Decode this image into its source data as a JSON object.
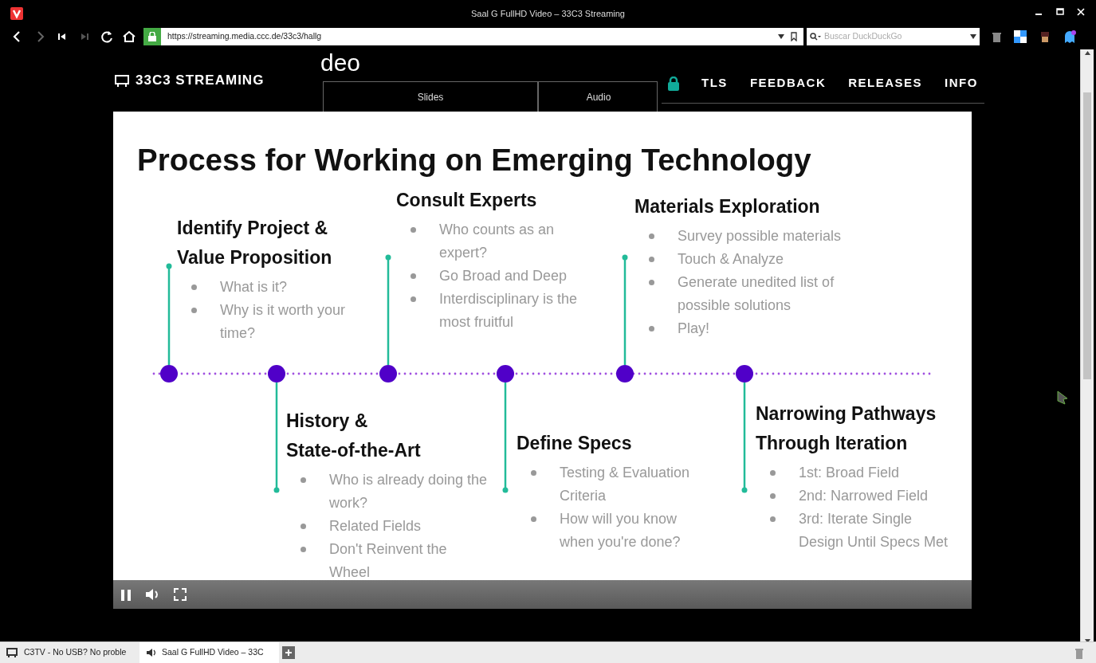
{
  "window": {
    "title": "Saal G FullHD Video – 33C3 Streaming"
  },
  "toolbar": {
    "url": "https://streaming.media.ccc.de/33c3/hallg",
    "search_placeholder": "Buscar DuckDuckGo"
  },
  "page": {
    "logo": "33C3 STREAMING",
    "heading_fragment": "deo",
    "tabs": [
      {
        "label": "Slides",
        "selected": false
      },
      {
        "label": "Audio",
        "selected": false
      }
    ],
    "nav": [
      "TLS",
      "FEEDBACK",
      "RELEASES",
      "INFO"
    ]
  },
  "slide": {
    "title": "Process for Working on Emerging Technology",
    "milestones": [
      {
        "kind": "above",
        "heading": [
          "Identify Project &",
          "Value Proposition"
        ],
        "bullets": [
          "What is it?",
          "Why is it worth your time?"
        ]
      },
      {
        "kind": "below",
        "heading": [
          "History &",
          "State-of-the-Art"
        ],
        "bullets": [
          "Who is already doing the work?",
          "Related Fields",
          "Don't Reinvent the Wheel"
        ]
      },
      {
        "kind": "above",
        "heading": [
          "Consult Experts"
        ],
        "bullets": [
          "Who counts as an expert?",
          "Go Broad and Deep",
          "Interdisciplinary is the most fruitful"
        ]
      },
      {
        "kind": "below",
        "heading": [
          "Define Specs"
        ],
        "bullets": [
          "Testing & Evaluation Criteria",
          "How will you know when you're done?"
        ]
      },
      {
        "kind": "above",
        "heading": [
          "Materials Exploration"
        ],
        "bullets": [
          "Survey possible materials",
          "Touch & Analyze",
          "Generate unedited list of possible solutions",
          "Play!"
        ]
      },
      {
        "kind": "below",
        "heading": [
          "Narrowing Pathways",
          "Through Iteration"
        ],
        "bullets": [
          "1st: Broad Field",
          "2nd: Narrowed Field",
          "3rd: Iterate Single Design Until Specs Met"
        ]
      }
    ]
  },
  "player": {
    "playing": true
  },
  "tabs": [
    {
      "label": "C3TV - No USB? No proble",
      "selected": false,
      "kind": "page"
    },
    {
      "label": "Saal G FullHD Video – 33C",
      "selected": true,
      "kind": "audio"
    }
  ]
}
